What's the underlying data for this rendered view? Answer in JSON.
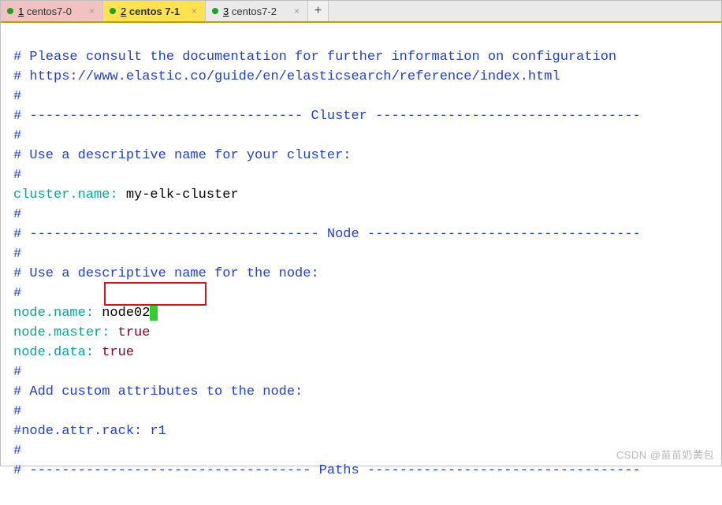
{
  "tabs": [
    {
      "num": "1",
      "label": "centos7-0"
    },
    {
      "num": "2",
      "label": "centos 7-1"
    },
    {
      "num": "3",
      "label": "centos7-2"
    }
  ],
  "add_tab_symbol": "+",
  "close_symbol": "×",
  "lines": {
    "l1": "# Please consult the documentation for further information on configuration",
    "l2": "# https://www.elastic.co/guide/en/elasticsearch/reference/index.html",
    "l3": "#",
    "l4a": "# ---------------------------------- Cluster ---------------------------------",
    "l5": "#",
    "l6": "# Use a descriptive name for your cluster:",
    "l7": "#",
    "k1": "cluster.name:",
    "v1": " my-elk-cluster",
    "l8": "#",
    "l9a": "# ------------------------------------ Node ----------------------------------",
    "l10": "#",
    "l11": "# Use a descriptive name for the node:",
    "l12": "#",
    "k2": "node.name:",
    "v2": " node02",
    "k3": "node.master:",
    "v3": " true",
    "k4": "node.data:",
    "v4": " true",
    "l13": "#",
    "l14": "# Add custom attributes to the node:",
    "l15": "#",
    "l16": "#node.attr.rack: r1",
    "l17": "#",
    "l18a": "# ----------------------------------- Paths ----------------------------------"
  },
  "watermark": "CSDN @苗苗奶黄包"
}
